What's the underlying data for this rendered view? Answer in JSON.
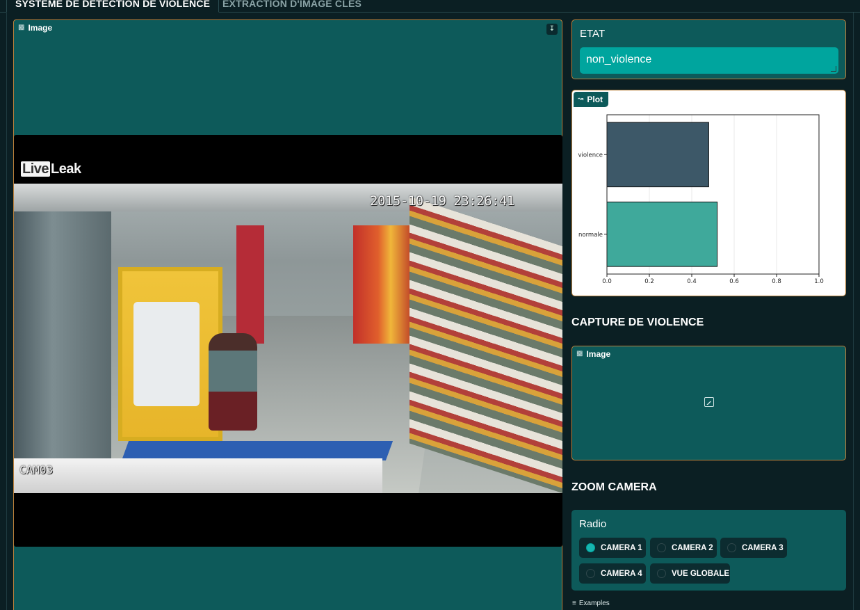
{
  "tabs": [
    {
      "label": "SYSTÈME DE DÉTECTION DE VIOLENCE",
      "active": true
    },
    {
      "label": "EXTRACTION D'IMAGE CLÉS",
      "active": false
    }
  ],
  "image_panel": {
    "label": "Image",
    "icon": "image-icon",
    "download_icon": "download-icon",
    "video": {
      "timestamp": "2015-10-19 23:26:41",
      "camera_tag": "CAM03",
      "logo_part1": "Live",
      "logo_part2": "Leak"
    }
  },
  "etat": {
    "label": "ETAT",
    "value": "non_violence"
  },
  "plot": {
    "label": "Plot",
    "icon": "chart-icon"
  },
  "chart_data": {
    "type": "bar",
    "orientation": "horizontal",
    "categories": [
      "violence",
      "normale"
    ],
    "values": [
      0.48,
      0.52
    ],
    "colors": [
      "#3d5868",
      "#3fa99b"
    ],
    "xlim": [
      0,
      1.0
    ],
    "xticks": [
      "0.0",
      "0.2",
      "0.4",
      "0.6",
      "0.8",
      "1.0"
    ],
    "grid": true,
    "title": "",
    "xlabel": "",
    "ylabel": ""
  },
  "capture": {
    "title": "CAPTURE DE VIOLENCE",
    "image_label": "Image",
    "image_icon": "image-icon",
    "placeholder_icon": "image-placeholder-icon"
  },
  "zoom": {
    "title": "ZOOM CAMERA",
    "radio_label": "Radio",
    "options": [
      {
        "label": "CAMERA 1",
        "selected": true
      },
      {
        "label": "CAMERA 2",
        "selected": false
      },
      {
        "label": "CAMERA 3",
        "selected": false
      },
      {
        "label": "CAMERA 4",
        "selected": false
      },
      {
        "label": "VUE GLOBALE",
        "selected": false
      }
    ]
  },
  "examples": {
    "label": "Examples",
    "icon": "list-icon"
  },
  "colors": {
    "background": "#0b1f23",
    "panel": "#0d5a5a",
    "panel_border": "#b9803b",
    "accent": "#00a59e"
  }
}
